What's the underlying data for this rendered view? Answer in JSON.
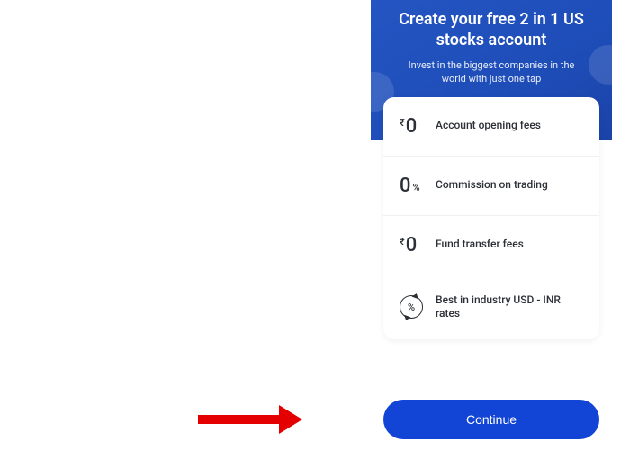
{
  "hero": {
    "title": "Create your free 2 in 1 US stocks account",
    "subtitle": "Invest in the biggest companies in the world with just one tap"
  },
  "features": [
    {
      "icon_prefix": "₹",
      "icon_value": "0",
      "icon_suffix": "",
      "label": "Account opening fees"
    },
    {
      "icon_prefix": "",
      "icon_value": "0",
      "icon_suffix": "%",
      "label": "Commission on trading"
    },
    {
      "icon_prefix": "₹",
      "icon_value": "0",
      "icon_suffix": "",
      "label": "Fund transfer fees"
    },
    {
      "icon_prefix": "",
      "icon_value": "%",
      "icon_suffix": "",
      "label": "Best in industry USD - INR rates"
    }
  ],
  "cta": {
    "label": "Continue"
  }
}
